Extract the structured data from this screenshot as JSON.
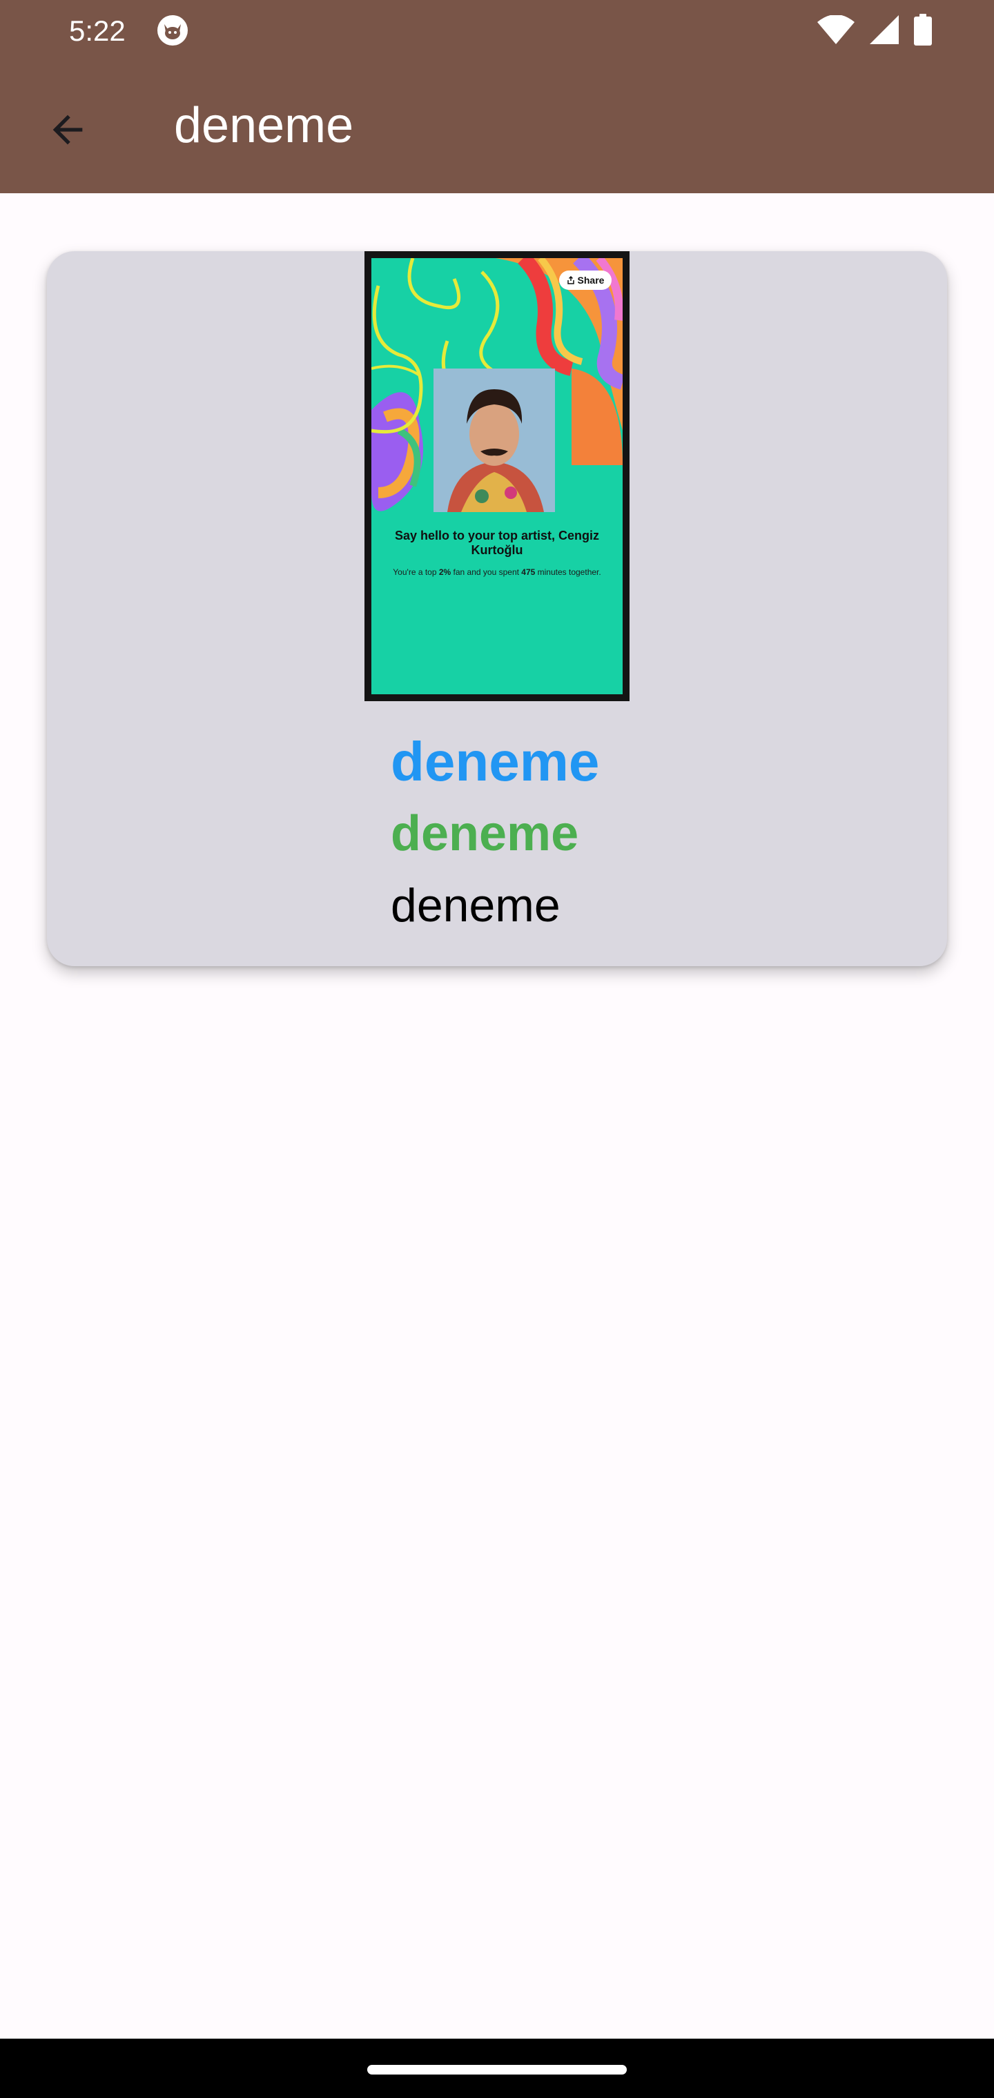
{
  "status_bar": {
    "time": "5:22"
  },
  "toolbar": {
    "title": "deneme"
  },
  "card": {
    "image": {
      "share_label": "Share",
      "headline": "Say hello to your top artist, Cengiz Kurtoğlu",
      "sub_part1": "You're a top ",
      "sub_pct": "2%",
      "sub_part2": " fan and you spent ",
      "sub_minutes": "475",
      "sub_part3": " minutes together."
    },
    "title_blue": "deneme",
    "title_green": "deneme",
    "title_black": "deneme"
  },
  "colors": {
    "app_bar": "#795548",
    "card_bg": "#dad8e0",
    "accent_blue": "#2196f3",
    "accent_green": "#4caf50",
    "story_bg": "#17d1a5"
  }
}
